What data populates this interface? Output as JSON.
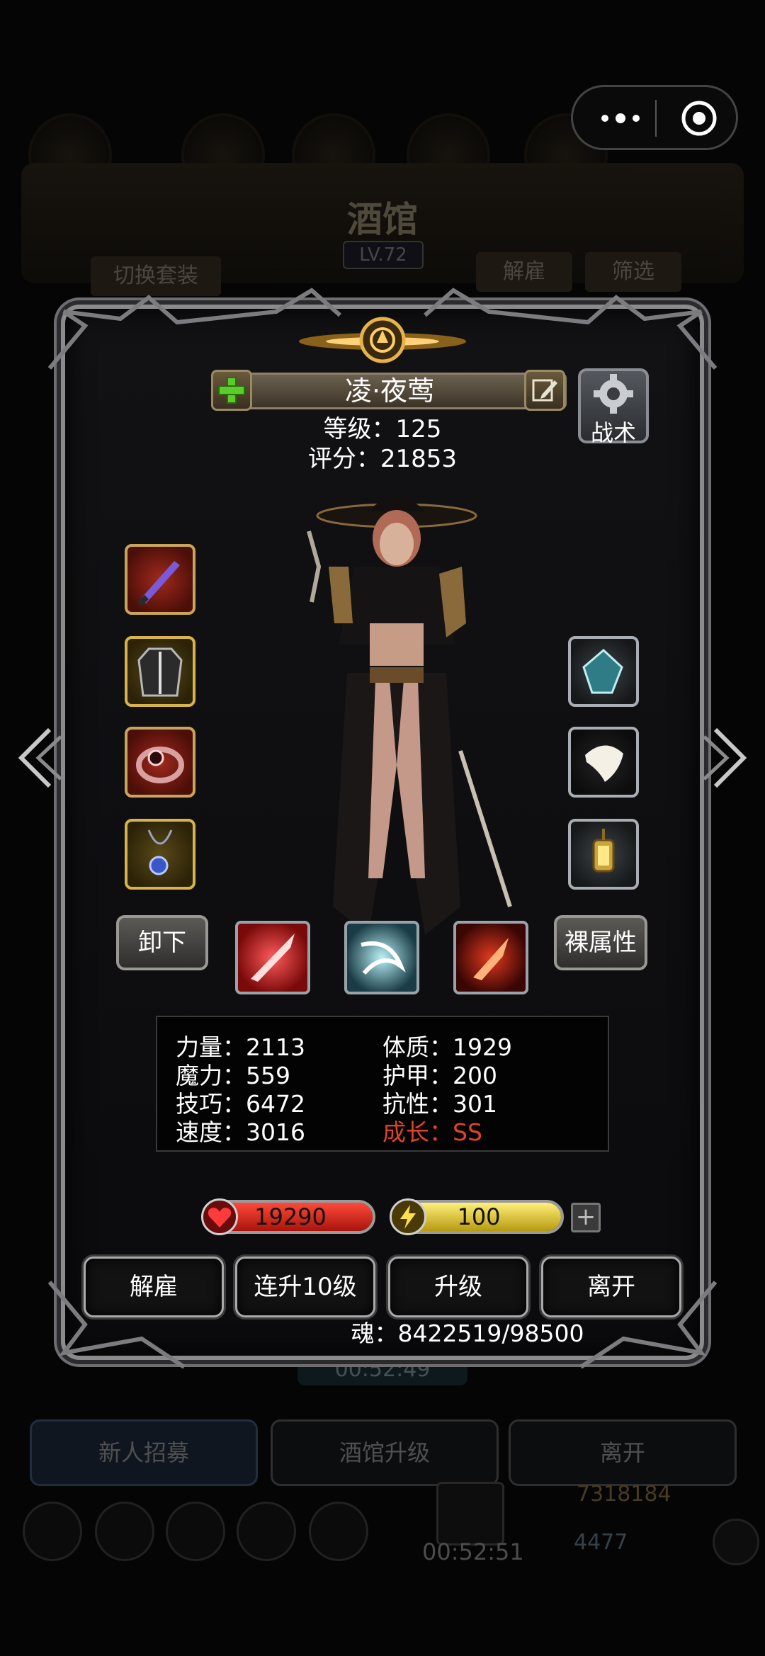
{
  "background": {
    "title": "酒馆",
    "level": "LV.72",
    "switch_outfit": "切换套装",
    "dismiss": "解雇",
    "filter": "筛选",
    "timer": "00:52:49",
    "tabs": [
      {
        "label": "新人招募"
      },
      {
        "label": "酒馆升级"
      },
      {
        "label": "离开"
      }
    ],
    "gold": "7318184",
    "gems": "4477",
    "timer2": "00:52:51"
  },
  "hero": {
    "name": "凌·夜莺",
    "level_text": "等级：125",
    "score_text": "评分：21853"
  },
  "tactics_label": "战术",
  "unequip_label": "卸下",
  "base_attr_label": "裸属性",
  "stats": {
    "strength": "力量：2113",
    "constitution": "体质：1929",
    "magic": "魔力：559",
    "armor": "护甲：200",
    "skill": "技巧：6472",
    "resistance": "抗性：301",
    "speed": "速度：3016",
    "growth": "成长：SS"
  },
  "hp": {
    "value": "19290",
    "fill": 1.0
  },
  "energy": {
    "value": "100",
    "fill": 1.0
  },
  "actions": {
    "dismiss": "解雇",
    "level_up_10": "连升10级",
    "level_up": "升级",
    "leave": "离开"
  },
  "soul_text": "魂：8422519/98500",
  "colors": {
    "hp_red": "#d8231c",
    "energy_yellow": "#d9c12a",
    "growth_red": "#e0432a"
  },
  "icons": {
    "left_slots": [
      "dagger-icon",
      "coat-armor-icon",
      "ring-icon",
      "amulet-icon"
    ],
    "right_slots": [
      "gem-icon",
      "feather-icon",
      "lantern-icon"
    ],
    "skills": [
      "red-slash-icon",
      "blue-swirl-icon",
      "fire-blade-icon"
    ]
  }
}
